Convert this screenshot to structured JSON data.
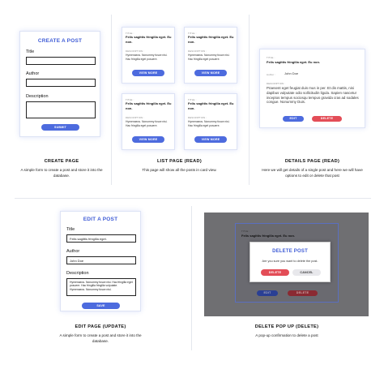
{
  "create": {
    "title": "CREATE A POST",
    "label_title": "Title",
    "label_author": "Author",
    "label_description": "Description",
    "submit": "SUBMIT",
    "caption": "CREATE PAGE",
    "caption_desc": "A simple form to create a post and store it into the database."
  },
  "list": {
    "tag_title": "TITLE :",
    "post_title": "Felis sagittis fringilla eget. Eu non.",
    "tag_desc": "DESCRIPTION :",
    "desc": "Hymenaeos. Nonummy fusce nisi. Hac fringilla eget posuere.",
    "view_more": "VIEW MORE",
    "caption": "LIST PAGE (READ)",
    "caption_desc": "This page will show all the posts in card view."
  },
  "details": {
    "tag_title": "TITLE :",
    "post_title": "Felis sagittis fringilla eget. Eu non.",
    "author_label": "Author :",
    "author": "John Doe",
    "tag_desc": "DESCRIPTION :",
    "desc": "Praesent eget feugiat duis mus in per. Et dis mattis, nisi dapibus vulputate odio sollicitudin ligula. Sapien nascetur inceptos tempus sociosqu tempus gravida cras ad sodales congue. Nonummy Duis.",
    "edit": "EDIT",
    "delete": "DELETE",
    "caption": "DETAILS PAGE (READ)",
    "caption_desc": "Here we will get details of a single post and here we will have options to edit or delete that post"
  },
  "edit": {
    "title": "EDIT A POST",
    "label_title": "Title",
    "value_title": "Felis sagittis fringilla eget.",
    "label_author": "Author",
    "value_author": "John Doe",
    "label_description": "Description",
    "value_description": "Hymenaeos. Nonummy fusce nisi. Hac fringilla eget posuere. Hac fringilla fringilla vulputate. Hymenaeos. Nonummy fusce nisi.",
    "save": "SAVE",
    "caption": "EDIT PAGE (UPDATE)",
    "caption_desc": "A simple form to create a post and store it into the database."
  },
  "delete_popup": {
    "bg_tag": "TITLE :",
    "bg_title": "Felis sagittis fringilla eget. Eu non.",
    "modal_title": "DELETE POST",
    "modal_text": "Are you sure you want to delete the post.",
    "delete": "DELETE",
    "cancel": "CANCEL",
    "bg_edit": "EDIT",
    "bg_delete": "DELETE",
    "caption": "DELETE POP UP (DELETE)",
    "caption_desc": "A pop-up confirmation to delete a post"
  }
}
